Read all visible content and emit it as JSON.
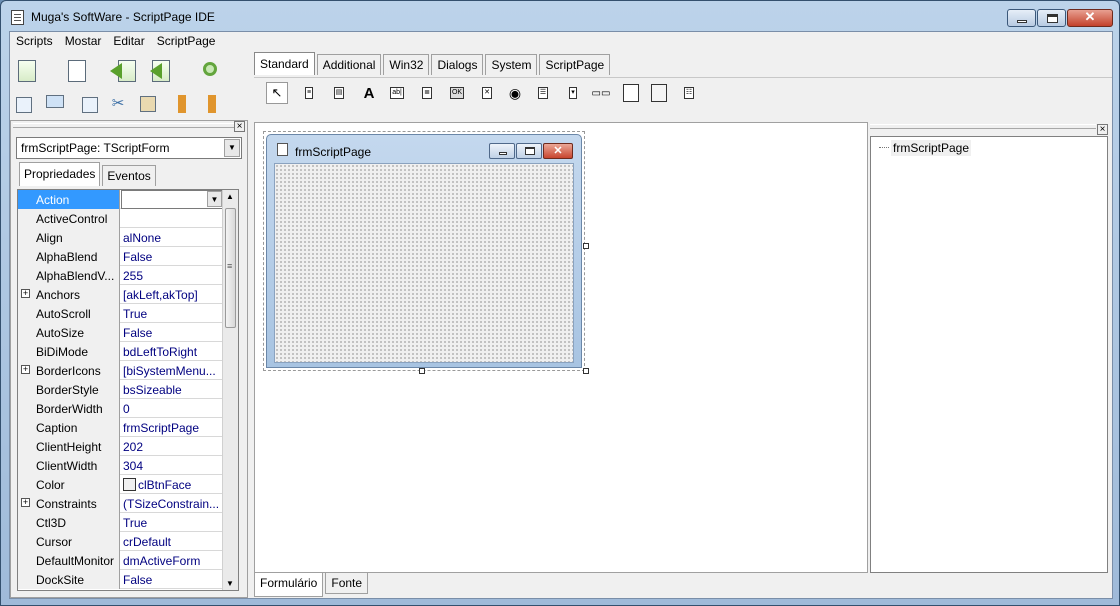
{
  "window": {
    "title": "Muga's SoftWare - ScriptPage IDE"
  },
  "menubar": [
    "Scripts",
    "Mostar",
    "Editar",
    "ScriptPage"
  ],
  "palette_tabs": [
    "Standard",
    "Additional",
    "Win32",
    "Dialogs",
    "System",
    "ScriptPage"
  ],
  "palette_icons": [
    "pointer-icon",
    "mainmenu-icon",
    "popupmenu-icon",
    "label-icon",
    "edit-icon",
    "memo-icon",
    "button-icon",
    "checkbox-icon",
    "radiobutton-icon",
    "listbox-icon",
    "combobox-icon",
    "scrollbar-icon",
    "groupbox-icon",
    "radiogroup-icon",
    "panel-icon"
  ],
  "object_inspector": {
    "selected_object": "frmScriptPage: TScriptForm",
    "tabs": [
      "Propriedades",
      "Eventos"
    ],
    "properties": [
      {
        "name": "Action",
        "value": ""
      },
      {
        "name": "ActiveControl",
        "value": ""
      },
      {
        "name": "Align",
        "value": "alNone"
      },
      {
        "name": "AlphaBlend",
        "value": "False"
      },
      {
        "name": "AlphaBlendV...",
        "value": "255"
      },
      {
        "name": "Anchors",
        "value": "[akLeft,akTop]"
      },
      {
        "name": "AutoScroll",
        "value": "True"
      },
      {
        "name": "AutoSize",
        "value": "False"
      },
      {
        "name": "BiDiMode",
        "value": "bdLeftToRight"
      },
      {
        "name": "BorderIcons",
        "value": "[biSystemMenu..."
      },
      {
        "name": "BorderStyle",
        "value": "bsSizeable"
      },
      {
        "name": "BorderWidth",
        "value": "0"
      },
      {
        "name": "Caption",
        "value": "frmScriptPage"
      },
      {
        "name": "ClientHeight",
        "value": "202"
      },
      {
        "name": "ClientWidth",
        "value": "304"
      },
      {
        "name": "Color",
        "value": "clBtnFace"
      },
      {
        "name": "Constraints",
        "value": "(TSizeConstrain..."
      },
      {
        "name": "Ctl3D",
        "value": "True"
      },
      {
        "name": "Cursor",
        "value": "crDefault"
      },
      {
        "name": "DefaultMonitor",
        "value": "dmActiveForm"
      },
      {
        "name": "DockSite",
        "value": "False"
      }
    ]
  },
  "designer": {
    "form_title": "frmScriptPage"
  },
  "bottom_tabs": [
    "Formulário",
    "Fonte"
  ],
  "tree": {
    "root": "frmScriptPage"
  }
}
